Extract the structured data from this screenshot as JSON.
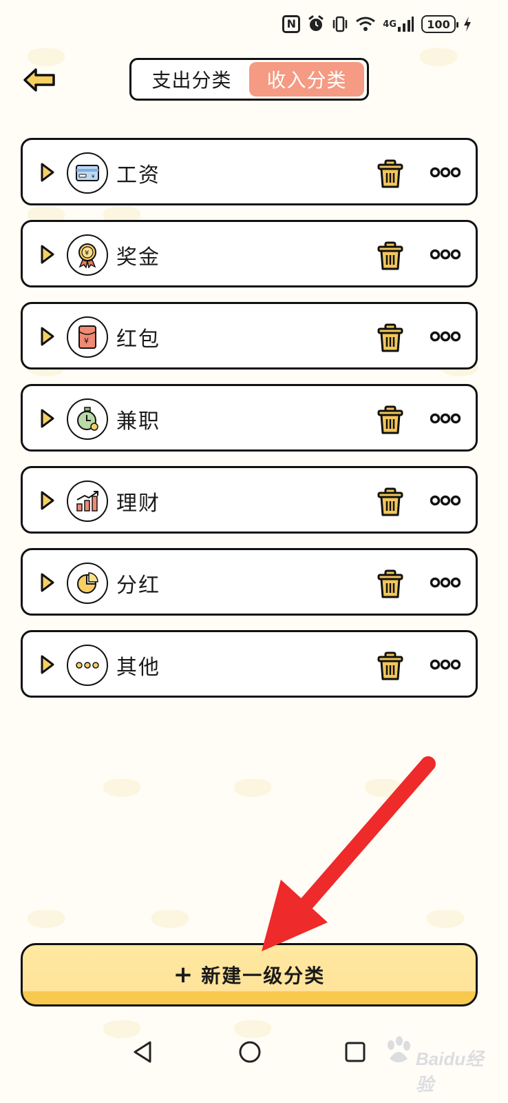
{
  "status_bar": {
    "network": "4G",
    "battery": "100"
  },
  "header": {
    "tabs": [
      {
        "label": "支出分类",
        "active": false
      },
      {
        "label": "收入分类",
        "active": true
      }
    ]
  },
  "categories": [
    {
      "label": "工资",
      "icon": "salary-card-icon"
    },
    {
      "label": "奖金",
      "icon": "bonus-medal-icon"
    },
    {
      "label": "红包",
      "icon": "red-envelope-icon"
    },
    {
      "label": "兼职",
      "icon": "part-time-stopwatch-icon"
    },
    {
      "label": "理财",
      "icon": "investment-chart-icon"
    },
    {
      "label": "分红",
      "icon": "dividend-pie-icon"
    },
    {
      "label": "其他",
      "icon": "other-dots-icon"
    }
  ],
  "new_button": {
    "label": "新建一级分类"
  },
  "watermark": {
    "text": "Baidu经验"
  },
  "colors": {
    "accent": "#f59a83",
    "trash": "#f2c65a",
    "button": "#ffe39a",
    "arrow": "#ee2a2a"
  }
}
